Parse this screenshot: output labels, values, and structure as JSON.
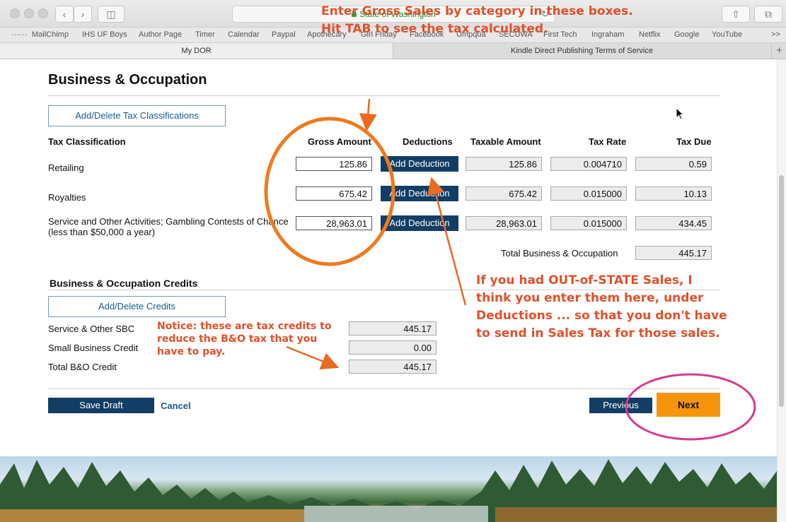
{
  "browser": {
    "address": "State of Washington",
    "bookmarks": [
      "MailChimp",
      "IHS UF Boys",
      "Author Page",
      "Timer",
      "Calendar",
      "Paypal",
      "Apothecary",
      "Girl Friday",
      "Facebook",
      "Umpqua",
      "SECUWA",
      "First Tech",
      "Ingraham",
      "Netflix",
      "Google",
      "YouTube"
    ],
    "overflow": ">>",
    "tabs": [
      "My DOR",
      "Kindle Direct Publishing Terms of Service"
    ]
  },
  "page": {
    "title": "Business & Occupation",
    "add_tax_btn": "Add/Delete Tax Classifications",
    "columns": {
      "classification": "Tax Classification",
      "gross": "Gross Amount",
      "deductions": "Deductions",
      "taxable": "Taxable Amount",
      "rate": "Tax Rate",
      "due": "Tax Due"
    },
    "rows": [
      {
        "label": "Retailing",
        "sub": "",
        "gross": "125.86",
        "deduction": "Add Deduction",
        "taxable": "125.86",
        "rate": "0.004710",
        "due": "0.59"
      },
      {
        "label": "Royalties",
        "sub": "",
        "gross": "675.42",
        "deduction": "Add Deduction",
        "taxable": "675.42",
        "rate": "0.015000",
        "due": "10.13"
      },
      {
        "label": "Service and Other Activities; Gambling Contests of Chance",
        "sub": "(less than $50,000 a year)",
        "gross": "28,963.01",
        "deduction": "Add Deduction",
        "taxable": "28,963.01",
        "rate": "0.015000",
        "due": "434.45"
      }
    ],
    "total_label": "Total Business & Occupation",
    "total_value": "445.17",
    "credits": {
      "title": "Business & Occupation Credits",
      "add_btn": "Add/Delete Credits",
      "items": [
        {
          "label": "Service & Other SBC",
          "value": "445.17"
        },
        {
          "label": "Small Business Credit",
          "value": "0.00"
        },
        {
          "label": "Total B&O Credit",
          "value": "445.17"
        }
      ]
    },
    "buttons": {
      "save": "Save Draft",
      "cancel": "Cancel",
      "previous": "Previous",
      "next": "Next"
    }
  },
  "annotations": {
    "gross": [
      "Enter Gross Sales by category in these boxes.",
      "Hit TAB to see the tax calculated."
    ],
    "credits": [
      "Notice: these are tax credits to",
      "reduce the B&O tax that you",
      "have to pay."
    ],
    "out_of_state": [
      "If you had OUT-of-STATE Sales, I",
      "think you enter them here, under",
      "Deductions ... so that you don't have",
      "to send in Sales Tax for those sales."
    ]
  },
  "colors": {
    "navy": "#123e66",
    "orange_button": "#f6940c",
    "annotation": "#e2502a",
    "circle_orange": "#f07a1c",
    "circle_pink": "#d63c8a"
  }
}
